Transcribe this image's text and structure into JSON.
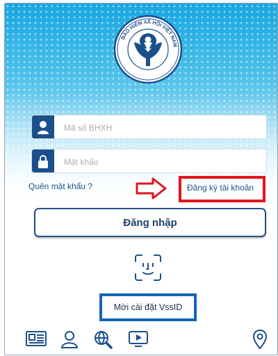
{
  "logo": {
    "ring_text": "BẢO HIỂM XÃ HỘI VIỆT NAM",
    "color": "#1b4f8c"
  },
  "login_form": {
    "id_field": {
      "placeholder": "Mã số BHXH",
      "value": "",
      "icon": "user-icon"
    },
    "password_field": {
      "placeholder": "Mật khẩu",
      "value": "",
      "icon": "lock-icon"
    },
    "forgot_password_label": "Quên mật khẩu ?",
    "register_label": "Đăng ký tài khoản",
    "login_button_label": "Đăng nhập"
  },
  "invite_label": "Mời cài đặt VssID",
  "bottom_nav": [
    {
      "icon": "news-icon"
    },
    {
      "icon": "person-icon"
    },
    {
      "icon": "search-globe-icon"
    },
    {
      "icon": "video-play-icon"
    },
    {
      "icon": "location-pin-icon"
    }
  ],
  "colors": {
    "primary": "#1b4f8c",
    "annotation_red": "#e3141d",
    "annotation_blue": "#1565b6"
  }
}
